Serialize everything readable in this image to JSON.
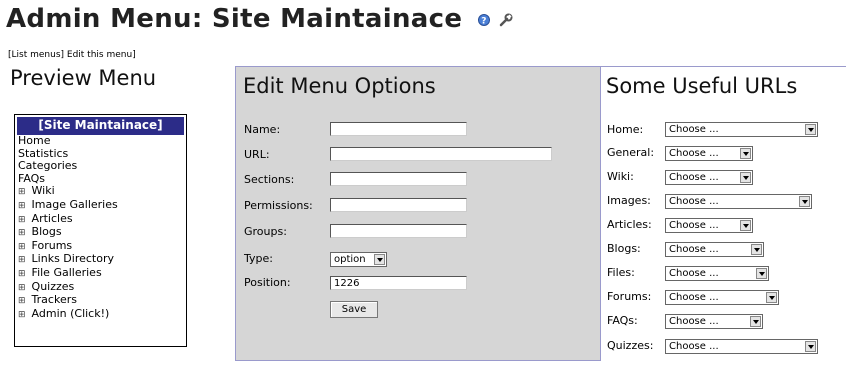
{
  "page": {
    "title": "Admin Menu: Site Maintainace",
    "title_icons": [
      "help-icon",
      "wrench-icon"
    ],
    "links": {
      "list_menus": "List menus",
      "edit_this_menu": "Edit this menu"
    }
  },
  "preview": {
    "heading": "Preview Menu",
    "menu_title": "[Site Maintainace]",
    "items": [
      {
        "label": "Home",
        "expandable": false
      },
      {
        "label": "Statistics",
        "expandable": false
      },
      {
        "label": "Categories",
        "expandable": false
      },
      {
        "label": "FAQs",
        "expandable": false
      },
      {
        "label": "Wiki",
        "expandable": true
      },
      {
        "label": "Image Galleries",
        "expandable": true
      },
      {
        "label": "Articles",
        "expandable": true
      },
      {
        "label": "Blogs",
        "expandable": true
      },
      {
        "label": "Forums",
        "expandable": true
      },
      {
        "label": "Links Directory",
        "expandable": true
      },
      {
        "label": "File Galleries",
        "expandable": true
      },
      {
        "label": "Quizzes",
        "expandable": true
      },
      {
        "label": "Trackers",
        "expandable": true
      },
      {
        "label": "Admin (Click!)",
        "expandable": true
      }
    ],
    "expand_glyph": "⊞"
  },
  "edit": {
    "heading": "Edit Menu Options",
    "fields": {
      "name": {
        "label": "Name:",
        "value": ""
      },
      "url": {
        "label": "URL:",
        "value": ""
      },
      "sections": {
        "label": "Sections:",
        "value": ""
      },
      "permissions": {
        "label": "Permissions:",
        "value": ""
      },
      "groups": {
        "label": "Groups:",
        "value": ""
      },
      "type": {
        "label": "Type:",
        "value": "option"
      },
      "position": {
        "label": "Position:",
        "value": "1226"
      }
    },
    "save_label": "Save"
  },
  "urls": {
    "heading": "Some Useful URLs",
    "rows": {
      "home": {
        "label": "Home:",
        "value": "Choose ..."
      },
      "general": {
        "label": "General:",
        "value": "Choose ..."
      },
      "wiki": {
        "label": "Wiki:",
        "value": "Choose ..."
      },
      "images": {
        "label": "Images:",
        "value": "Choose ..."
      },
      "articles": {
        "label": "Articles:",
        "value": "Choose ..."
      },
      "blogs": {
        "label": "Blogs:",
        "value": "Choose ..."
      },
      "files": {
        "label": "Files:",
        "value": "Choose ..."
      },
      "forums": {
        "label": "Forums:",
        "value": "Choose ..."
      },
      "faqs": {
        "label": "FAQs:",
        "value": "Choose ..."
      },
      "quizzes": {
        "label": "Quizzes:",
        "value": "Choose ..."
      }
    }
  },
  "colors": {
    "menu_title_bg": "#2c2c88",
    "panel_bg": "#d6d6d6",
    "panel_border": "#9a9acc"
  }
}
